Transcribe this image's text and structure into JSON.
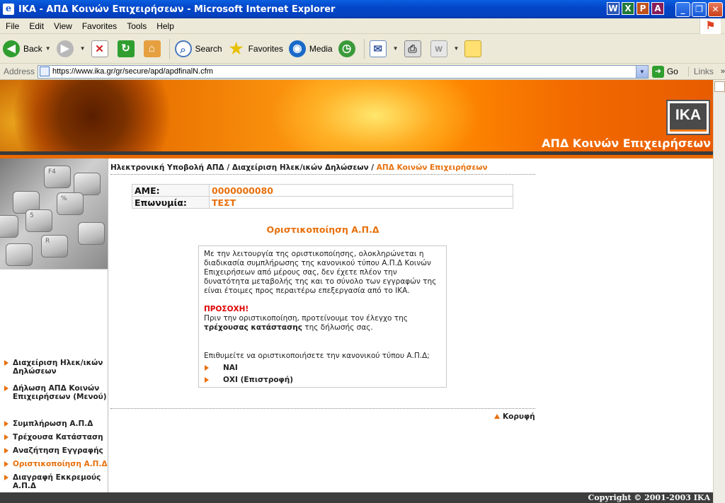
{
  "window": {
    "title": "ΙΚΑ - ΑΠΔ Κοινών Επιχειρήσεων - Microsoft Internet Explorer",
    "taskbar_icons": [
      "W",
      "X",
      "P",
      "A"
    ]
  },
  "menubar": {
    "items": [
      "File",
      "Edit",
      "View",
      "Favorites",
      "Tools",
      "Help"
    ]
  },
  "toolbar": {
    "back": "Back",
    "search": "Search",
    "favorites": "Favorites",
    "media": "Media"
  },
  "addressbar": {
    "label": "Address",
    "url": "https://www.ika.gr/gr/secure/apd/apdfinalN.cfm",
    "go": "Go",
    "links": "Links"
  },
  "banner": {
    "logo_text": "ΙΚΑ",
    "title": "ΑΠΔ Κοινών Επιχειρήσεων"
  },
  "sidebar": {
    "keys": [
      "F4",
      "%",
      "5",
      "4",
      "R"
    ],
    "items": [
      {
        "line1": "Διαχείριση Ηλεκ/ικών",
        "line2": "Δηλώσεων",
        "active": false
      },
      {
        "line1": "Δήλωση ΑΠΔ Κοινών",
        "line2": "Επιχειρήσεων (Μενού)",
        "active": false
      },
      {
        "line1": "Συμπλήρωση Α.Π.Δ",
        "line2": "",
        "active": false
      },
      {
        "line1": "Τρέχουσα Κατάσταση",
        "line2": "",
        "active": false
      },
      {
        "line1": "Αναζήτηση Εγγραφής",
        "line2": "",
        "active": false
      },
      {
        "line1": "Οριστικοποίηση Α.Π.Δ",
        "line2": "",
        "active": true
      },
      {
        "line1": "Διαγραφή Εκκρεμούς",
        "line2": "Α.Π.Δ",
        "active": false
      }
    ]
  },
  "breadcrumb": {
    "part1": "Ηλεκτρονική Υποβολή ΑΠΔ",
    "sep": " / ",
    "part2": "Διαχείριση Ηλεκ/ικών Δηλώσεων",
    "current": "ΑΠΔ Κοινών Επιχειρήσεων"
  },
  "employer": {
    "ame_label": "ΑΜΕ:",
    "ame_value": "0000000080",
    "name_label": "Επωνυμία:",
    "name_value": "ΤΕΣΤ"
  },
  "finalize": {
    "title": "Οριστικοποίηση Α.Π.Δ",
    "description": "Με την λειτουργία της οριστικοποίησης, ολοκληρώνεται η διαδικασία συμπλήρωσης της κανονικού τύπου Α.Π.Δ Κοινών Επιχειρήσεων από μέρους σας, δεν έχετε πλέον την δυνατότητα μεταβολής της και το σύνολο των εγγραφών της είναι έτοιμες προς περαιτέρω επεξεργασία από το ΙΚΑ.",
    "warning_label": "ΠΡΟΣΟΧΗ!",
    "warning_text_1": "Πριν την οριστικοποίηση, προτείνουμε τον έλεγχο της ",
    "warning_text_bold": "τρέχουσας κατάστασης",
    "warning_text_2": " της δήλωσής σας.",
    "question": "Επιθυμείτε να οριστικοποιήσετε την κανονικού τύπου Α.Π.Δ;",
    "yes": "ΝΑΙ",
    "no": "ΟΧΙ (Επιστροφή)"
  },
  "top_link": "Κορυφή",
  "footer": "Copyright © 2001-2003 ΙΚΑ",
  "colors": {
    "accent": "#e8700c",
    "warning": "#e00000",
    "titlebar": "#0346c8"
  }
}
